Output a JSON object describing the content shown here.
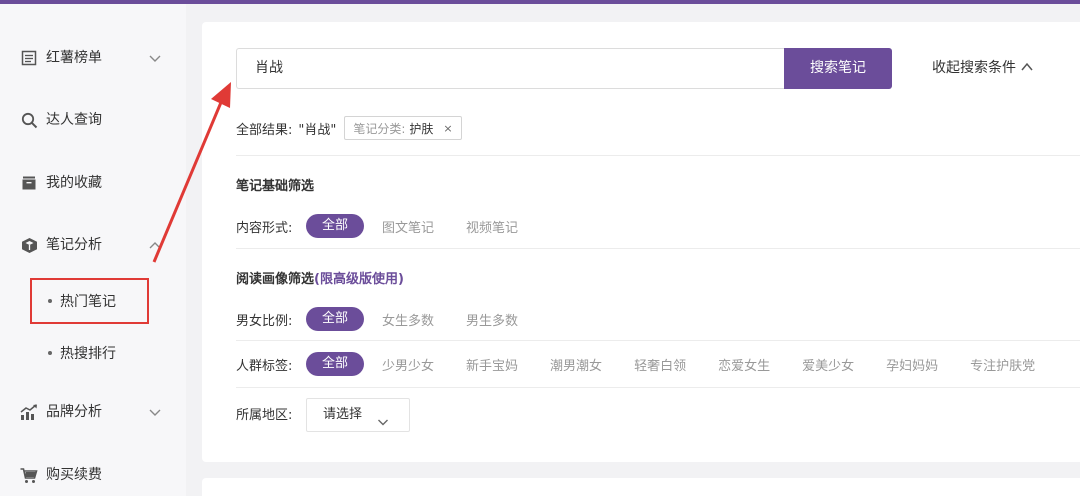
{
  "sidebar": {
    "items": [
      {
        "label": "红薯榜单",
        "icon": "list-icon",
        "chevron": "down"
      },
      {
        "label": "达人查询",
        "icon": "search-icon"
      },
      {
        "label": "我的收藏",
        "icon": "folder-icon"
      },
      {
        "label": "笔记分析",
        "icon": "box-icon",
        "chevron": "up"
      },
      {
        "label": "品牌分析",
        "icon": "chart-icon",
        "chevron": "down"
      },
      {
        "label": "购买续费",
        "icon": "cart-icon"
      }
    ],
    "sub_items": [
      {
        "label": "热门笔记",
        "highlighted": true
      },
      {
        "label": "热搜排行"
      }
    ]
  },
  "search": {
    "value": "肖战",
    "button_label": "搜索笔记",
    "collapse_label": "收起搜索条件"
  },
  "results": {
    "prefix": "全部结果:",
    "query": "\"肖战\"",
    "chip_key": "笔记分类:",
    "chip_value": "护肤",
    "chip_close": "×"
  },
  "basic_filter": {
    "title": "笔记基础筛选",
    "content_type": {
      "label": "内容形式:",
      "options": [
        "全部",
        "图文笔记",
        "视频笔记"
      ]
    }
  },
  "reader_filter": {
    "title": "阅读画像筛选",
    "title_suffix": "(限高级版使用)",
    "gender": {
      "label": "男女比例:",
      "options": [
        "全部",
        "女生多数",
        "男生多数"
      ]
    },
    "crowd": {
      "label": "人群标签:",
      "options": [
        "全部",
        "少男少女",
        "新手宝妈",
        "潮男潮女",
        "轻奢白领",
        "恋爱女生",
        "爱美少女",
        "孕妇妈妈",
        "专注护肤党"
      ]
    },
    "region": {
      "label": "所属地区:",
      "placeholder": "请选择"
    }
  },
  "colors": {
    "accent": "#6b4d9a",
    "annotation": "#e03a36"
  }
}
